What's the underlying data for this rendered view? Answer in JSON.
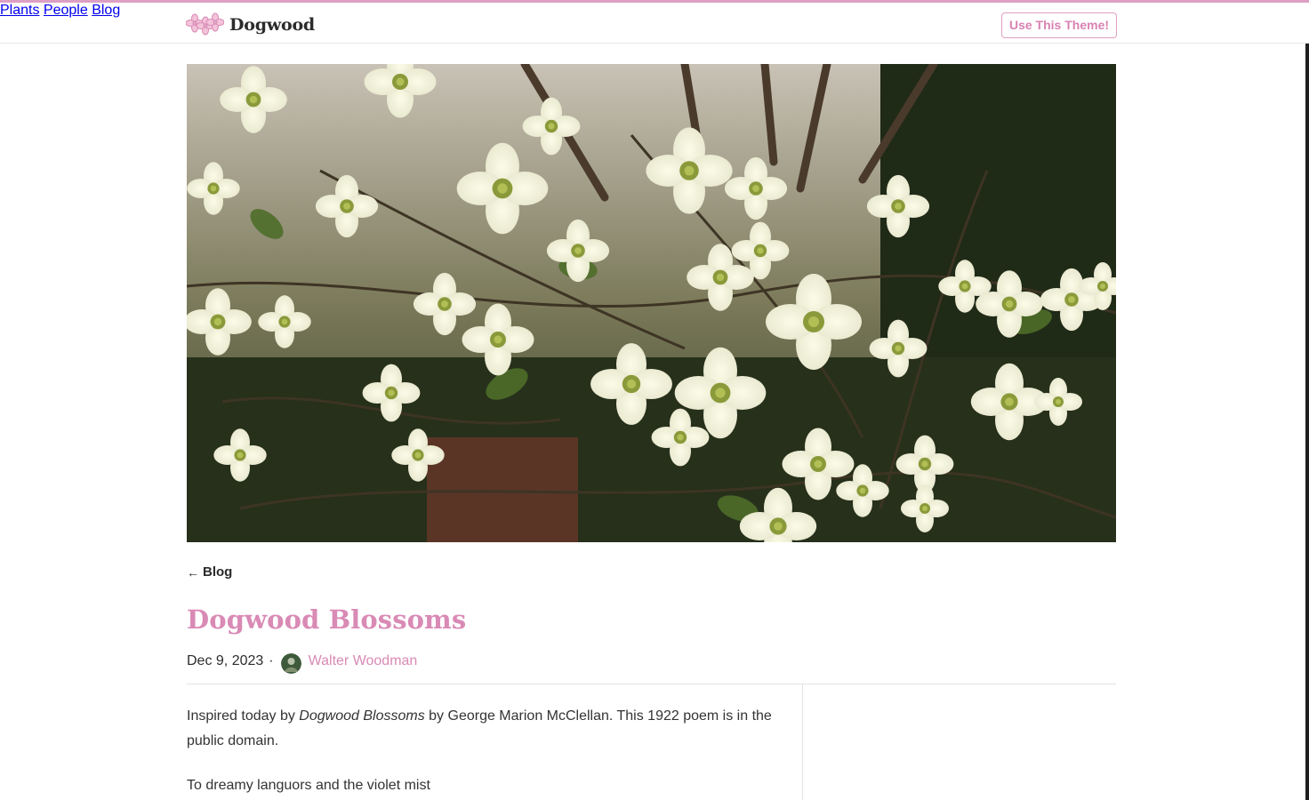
{
  "brand": {
    "name": "Dogwood",
    "logo_icon": "dogwood-flowers-icon"
  },
  "nav": {
    "items": [
      "Plants",
      "People",
      "Blog"
    ],
    "cta": "Use This Theme!"
  },
  "colors": {
    "accent": "#dd9fc3",
    "title": "#d98ab5",
    "text": "#2d2d2d"
  },
  "hero": {
    "icon": "dogwood-blossoms-photo"
  },
  "back_link": {
    "label": "Blog",
    "icon": "arrow-left-icon"
  },
  "post": {
    "title": "Dogwood Blossoms",
    "date": "Dec 9, 2023",
    "separator": "·",
    "author": "Walter Woodman",
    "intro_before": "Inspired today by ",
    "intro_italic": "Dogwood Blossoms",
    "intro_after": " by George Marion McClellan. This 1922 poem is in the public domain.",
    "first_line": "To dreamy languors and the violet mist"
  }
}
